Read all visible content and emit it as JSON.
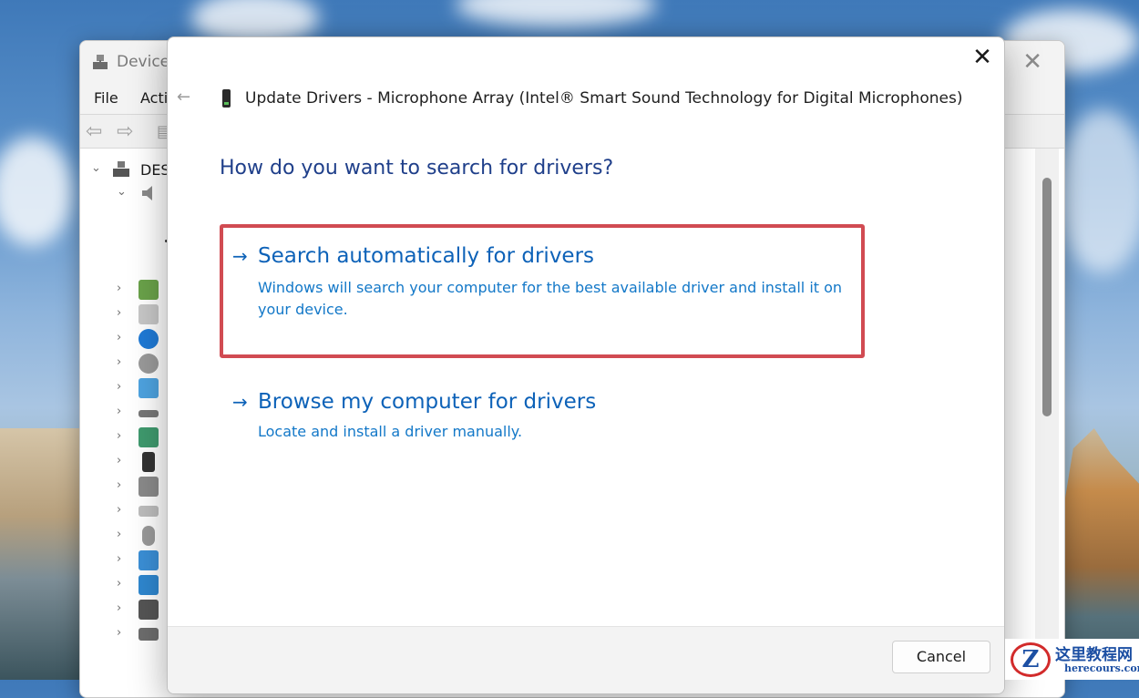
{
  "desktop": {
    "wallpaper_colors": [
      "#3f79b9",
      "#a9c5e2",
      "#45626a"
    ]
  },
  "device_manager": {
    "title": "Device",
    "close_glyph": "✕",
    "menu": {
      "file": "File",
      "action": "Acti"
    },
    "tree_root_label": "DES"
  },
  "dialog": {
    "close_glyph": "✕",
    "back_glyph": "←",
    "title": "Update Drivers - Microphone Array (Intel® Smart Sound Technology for Digital Microphones)",
    "question": "How do you want to search for drivers?",
    "options": [
      {
        "arrow": "→",
        "heading": "Search automatically for drivers",
        "description_line1": "Windows will search your computer for the best available driver and install it on",
        "description_line2": "your device."
      },
      {
        "arrow": "→",
        "heading": "Browse my computer for drivers",
        "description_line1": "Locate and install a driver manually."
      }
    ],
    "cancel_label": "Cancel",
    "highlight_color": "#d14b52",
    "link_color": "#0d62b8"
  },
  "watermark": {
    "logo_letter": "Z",
    "chinese_text": "这里教程网",
    "site": "herecours.com"
  }
}
